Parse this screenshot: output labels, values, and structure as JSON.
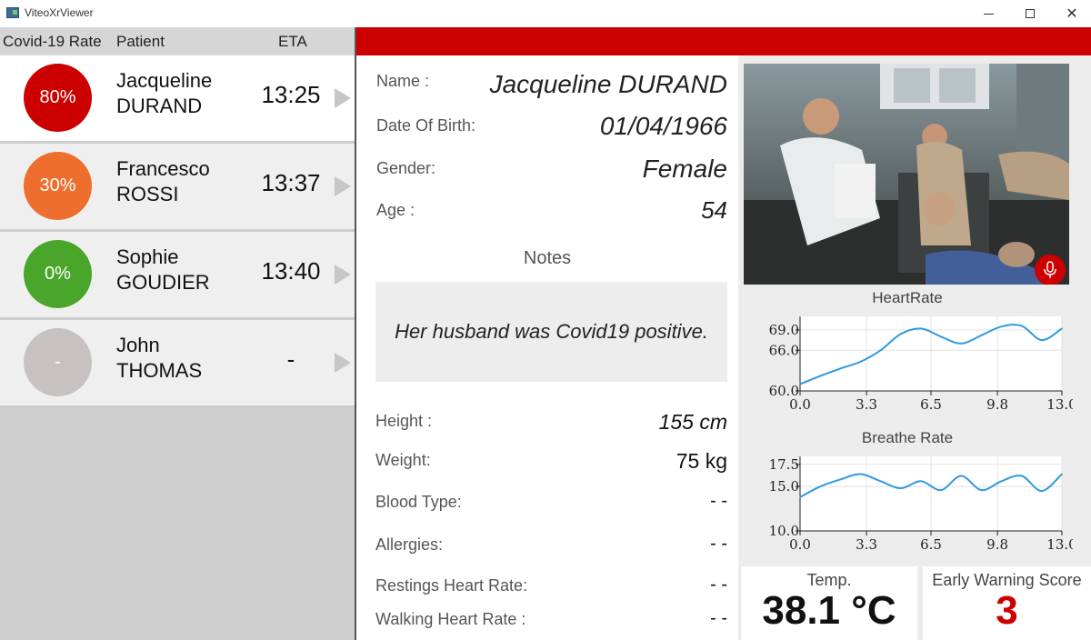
{
  "window": {
    "title": "ViteoXrViewer"
  },
  "patient_list": {
    "headers": {
      "rate": "Covid-19 Rate",
      "patient": "Patient",
      "eta": "ETA"
    },
    "patients": [
      {
        "rate": "80%",
        "first": "Jacqueline",
        "last": "DURAND",
        "eta": "13:25",
        "color": "#cc0000"
      },
      {
        "rate": "30%",
        "first": "Francesco",
        "last": "ROSSI",
        "eta": "13:37",
        "color": "#ee6f2d"
      },
      {
        "rate": "0%",
        "first": "Sophie",
        "last": "GOUDIER",
        "eta": "13:40",
        "color": "#4aa62a"
      },
      {
        "rate": "-",
        "first": "John",
        "last": "THOMAS",
        "eta": "-",
        "color": "#c7c2c2"
      }
    ]
  },
  "details": {
    "name_label": "Name :",
    "name": "Jacqueline DURAND",
    "dob_label": "Date Of Birth:",
    "dob": "01/04/1966",
    "gender_label": "Gender:",
    "gender": "Female",
    "age_label": "Age :",
    "age": "54",
    "notes_title": "Notes",
    "notes": "Her husband was Covid19 positive.",
    "height_label": "Height :",
    "height": "155 cm",
    "weight_label": "Weight:",
    "weight": "75 kg",
    "blood_label": "Blood Type:",
    "blood": "- -",
    "allergies_label": "Allergies:",
    "allergies": "- -",
    "resting_label": "Restings Heart Rate:",
    "resting": "- -",
    "walking_label": "Walking Heart Rate :",
    "walking": "- -"
  },
  "vitals": {
    "temp_label": "Temp.",
    "temp": "38.1 °C",
    "ews_label": "Early Warning Score",
    "ews": "3"
  },
  "accent_color": "#cc0000",
  "chart_data": [
    {
      "type": "line",
      "title": "HeartRate",
      "x": [
        0,
        1,
        2,
        3,
        4,
        5,
        6,
        7,
        8,
        9,
        10,
        11,
        12,
        13
      ],
      "series": [
        {
          "values": [
            61.0,
            62.2,
            63.3,
            64.3,
            66.0,
            68.4,
            69.2,
            68.0,
            67.0,
            68.2,
            69.5,
            69.6,
            67.5,
            69.2
          ]
        }
      ],
      "xticks": [
        "0.0",
        "3.3",
        "6.5",
        "9.8",
        "13.0"
      ],
      "yticks": [
        "60.0",
        "66.0",
        "69.0"
      ],
      "ytick_values": [
        60,
        66,
        69
      ],
      "xlim": [
        0,
        13
      ],
      "ylim": [
        60,
        71
      ],
      "grid": true
    },
    {
      "type": "line",
      "title": "Breathe Rate",
      "x": [
        0,
        1,
        2,
        3,
        4,
        5,
        6,
        7,
        8,
        9,
        10,
        11,
        12,
        13
      ],
      "series": [
        {
          "values": [
            13.8,
            15.0,
            15.8,
            16.4,
            15.6,
            14.8,
            15.6,
            14.6,
            16.2,
            14.6,
            15.6,
            16.2,
            14.5,
            16.4
          ]
        }
      ],
      "xticks": [
        "0.0",
        "3.3",
        "6.5",
        "9.8",
        "13.0"
      ],
      "yticks": [
        "10.0",
        "15.0",
        "17.5"
      ],
      "ytick_values": [
        10,
        15,
        17.5
      ],
      "xlim": [
        0,
        13
      ],
      "ylim": [
        10,
        18.4
      ],
      "grid": true
    }
  ]
}
